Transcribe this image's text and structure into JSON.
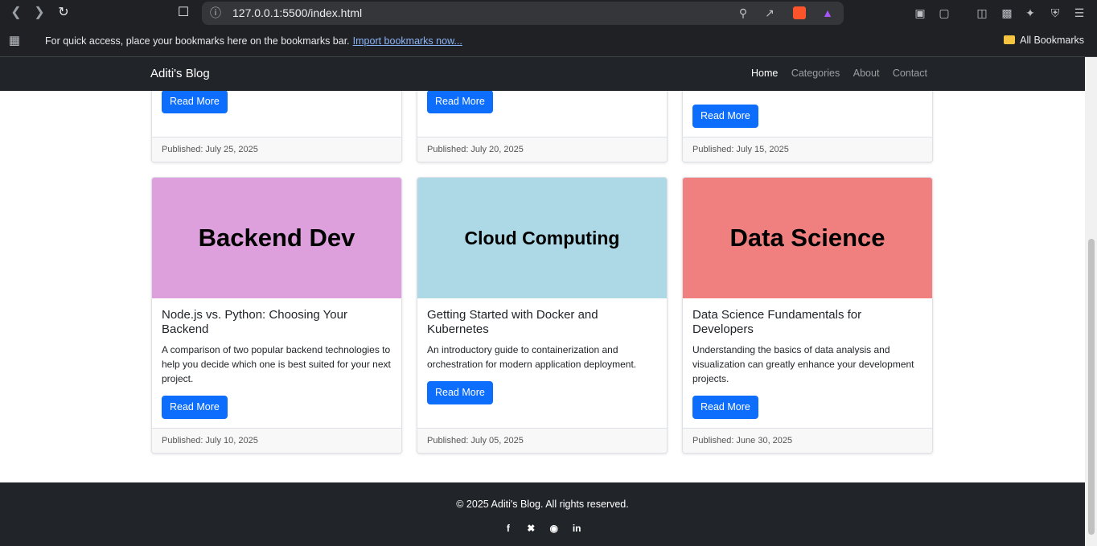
{
  "browser": {
    "url": "127.0.0.1:5500/index.html",
    "bookmarks_hint": "For quick access, place your bookmarks here on the bookmarks bar.",
    "bookmarks_import": "Import bookmarks now...",
    "all_bookmarks": "All Bookmarks"
  },
  "navbar": {
    "brand": "Aditi's Blog",
    "links": [
      "Home",
      "Categories",
      "About",
      "Contact"
    ]
  },
  "top_row": [
    {
      "button": "Read More",
      "published": "Published: July 25, 2025"
    },
    {
      "button": "Read More",
      "published": "Published: July 20, 2025"
    },
    {
      "button": "Read More",
      "published": "Published: July 15, 2025"
    }
  ],
  "posts": [
    {
      "image_label": "Backend Dev",
      "image_color": "#dda0dd",
      "title": "Node.js vs. Python: Choosing Your Backend",
      "text": "A comparison of two popular backend technologies to help you decide which one is best suited for your next project.",
      "button": "Read More",
      "published": "Published: July 10, 2025"
    },
    {
      "image_label": "Cloud Computing",
      "image_color": "#add8e6",
      "title": "Getting Started with Docker and Kubernetes",
      "text": "An introductory guide to containerization and orchestration for modern application deployment.",
      "button": "Read More",
      "published": "Published: July 05, 2025"
    },
    {
      "image_label": "Data Science",
      "image_color": "#f08080",
      "title": "Data Science Fundamentals for Developers",
      "text": "Understanding the basics of data analysis and visualization can greatly enhance your development projects.",
      "button": "Read More",
      "published": "Published: June 30, 2025"
    }
  ],
  "footer": {
    "copyright": "© 2025 Aditi's Blog. All rights reserved.",
    "socials": [
      "facebook-icon",
      "twitter-icon",
      "instagram-icon",
      "linkedin-icon"
    ]
  }
}
